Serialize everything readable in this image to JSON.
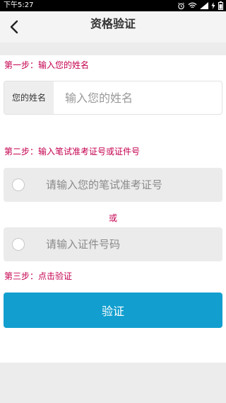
{
  "status_bar": {
    "time": "下午5:27"
  },
  "nav": {
    "title": "资格验证"
  },
  "steps": {
    "step1_label": "第一步：输入您的姓名",
    "name_field_label": "您的姓名",
    "name_field_placeholder": "输入您的姓名",
    "step2_label": "第二步：输入笔试准考证号或证件号",
    "exam_number_placeholder": "请输入您的笔试准考证号",
    "or_text": "或",
    "id_number_placeholder": "请输入证件号码",
    "step3_label": "第三步：点击验证"
  },
  "verify_button": {
    "label": "验证",
    "color": "#129fcf"
  },
  "accent_color": "#c4004f",
  "icons": [
    "alarm-icon",
    "wifi-icon",
    "signal-icon",
    "charging-icon",
    "battery-icon",
    "back-chevron-icon"
  ]
}
